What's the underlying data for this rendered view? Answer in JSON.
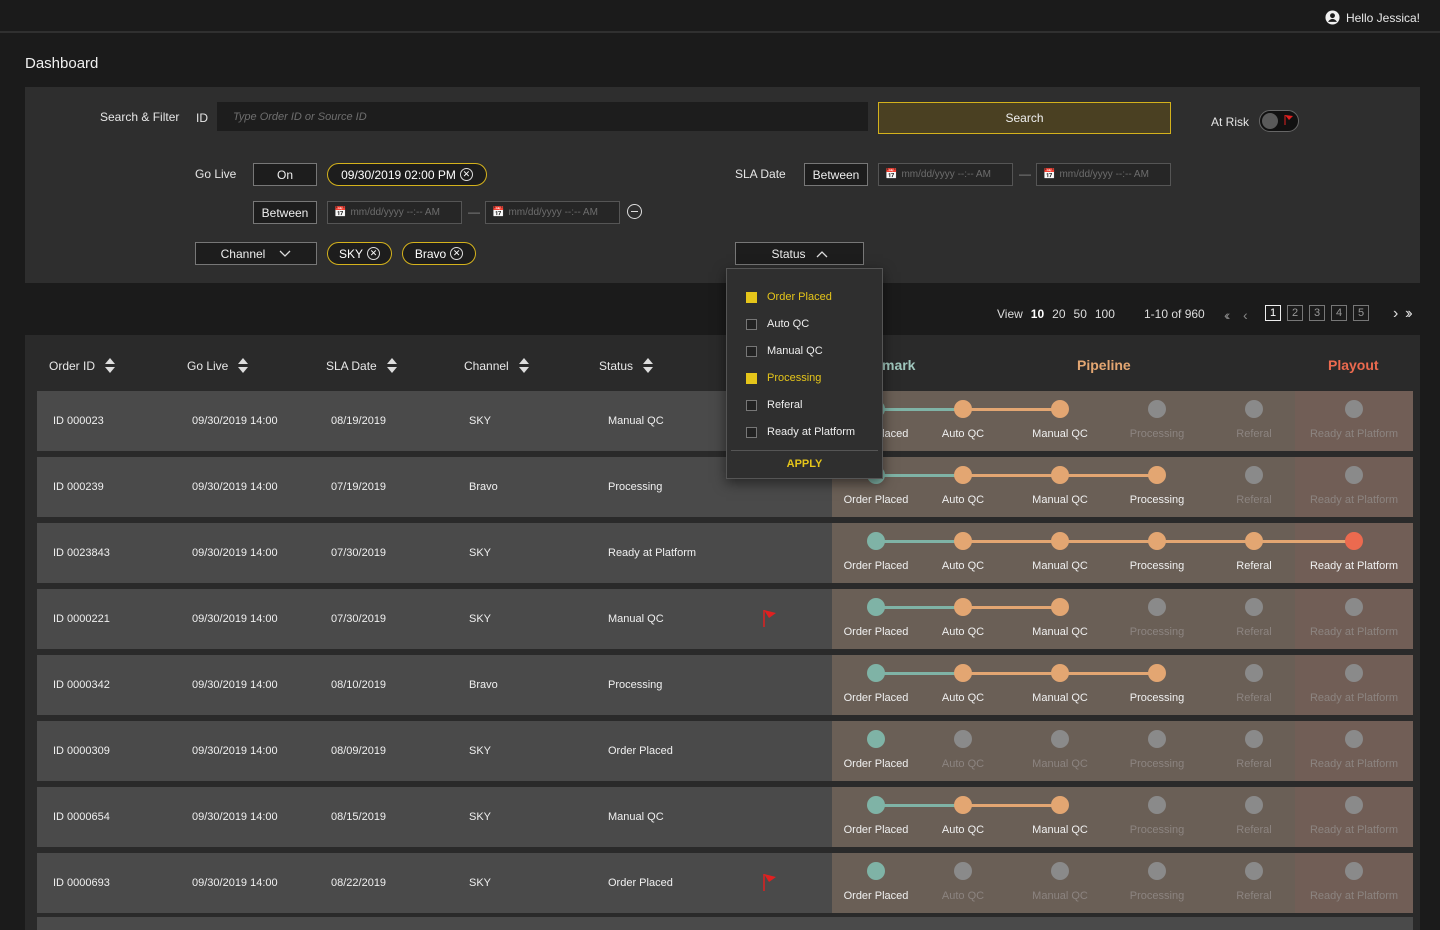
{
  "header": {
    "greeting": "Hello Jessica!"
  },
  "page": {
    "title": "Dashboard"
  },
  "filters": {
    "search_label": "Search & Filter",
    "id_label": "ID",
    "id_placeholder": "Type Order ID or Source ID",
    "search_button": "Search",
    "at_risk_label": "At Risk",
    "go_live_label": "Go Live",
    "go_live_mode": "On",
    "go_live_value": "09/30/2019 02:00 PM",
    "between_label": "Between",
    "date_placeholder": "mm/dd/yyyy --:-- AM",
    "sla_label": "SLA Date",
    "sla_mode": "Between",
    "channel_label": "Channel",
    "channel_chips": [
      "SKY",
      "Bravo"
    ],
    "status_label": "Status"
  },
  "status_dropdown": {
    "options": [
      {
        "label": "Order Placed",
        "checked": true
      },
      {
        "label": "Auto QC",
        "checked": false
      },
      {
        "label": "Manual QC",
        "checked": false
      },
      {
        "label": "Processing",
        "checked": true
      },
      {
        "label": "Referal",
        "checked": false
      },
      {
        "label": "Ready at Platform",
        "checked": false
      }
    ],
    "apply": "APPLY"
  },
  "pagination": {
    "view_label": "View",
    "sizes": [
      "10",
      "20",
      "50",
      "100"
    ],
    "active_size": "10",
    "range": "1-10 of 960",
    "pages": [
      "1",
      "2",
      "3",
      "4",
      "5"
    ],
    "active_page": "1"
  },
  "table": {
    "columns": [
      "Order ID",
      "Go Live",
      "SLA Date",
      "Channel",
      "Status"
    ],
    "stage_headers": {
      "mark": "mark",
      "pipeline": "Pipeline",
      "playout": "Playout"
    },
    "stages": [
      "Order Placed",
      "Auto QC",
      "Manual QC",
      "Processing",
      "Referal",
      "Ready at Platform"
    ],
    "rows": [
      {
        "id": "ID 000023",
        "go_live": "09/30/2019 14:00",
        "sla": "08/19/2019",
        "channel": "SKY",
        "status": "Manual QC",
        "progress": 3,
        "flag": false
      },
      {
        "id": "ID 000239",
        "go_live": "09/30/2019 14:00",
        "sla": "07/19/2019",
        "channel": "Bravo",
        "status": "Processing",
        "progress": 4,
        "flag": false
      },
      {
        "id": "ID 0023843",
        "go_live": "09/30/2019 14:00",
        "sla": "07/30/2019",
        "channel": "SKY",
        "status": "Ready at Platform",
        "progress": 6,
        "flag": false
      },
      {
        "id": "ID 0000221",
        "go_live": "09/30/2019 14:00",
        "sla": "07/30/2019",
        "channel": "SKY",
        "status": "Manual QC",
        "progress": 3,
        "flag": true
      },
      {
        "id": "ID 0000342",
        "go_live": "09/30/2019 14:00",
        "sla": "08/10/2019",
        "channel": "Bravo",
        "status": "Processing",
        "progress": 4,
        "flag": false
      },
      {
        "id": "ID 0000309",
        "go_live": "09/30/2019 14:00",
        "sla": "08/09/2019",
        "channel": "SKY",
        "status": "Order Placed",
        "progress": 1,
        "flag": false
      },
      {
        "id": "ID 0000654",
        "go_live": "09/30/2019 14:00",
        "sla": "08/15/2019",
        "channel": "SKY",
        "status": "Manual QC",
        "progress": 3,
        "flag": false
      },
      {
        "id": "ID 0000693",
        "go_live": "09/30/2019 14:00",
        "sla": "08/22/2019",
        "channel": "SKY",
        "status": "Order Placed",
        "progress": 1,
        "flag": true
      }
    ]
  },
  "colors": {
    "accent": "#e5c51a",
    "teal": "#7fb3a6",
    "orange": "#e3a672",
    "red": "#ec6a4f",
    "grey_node": "#8a8a8a",
    "flag": "#e02020"
  }
}
